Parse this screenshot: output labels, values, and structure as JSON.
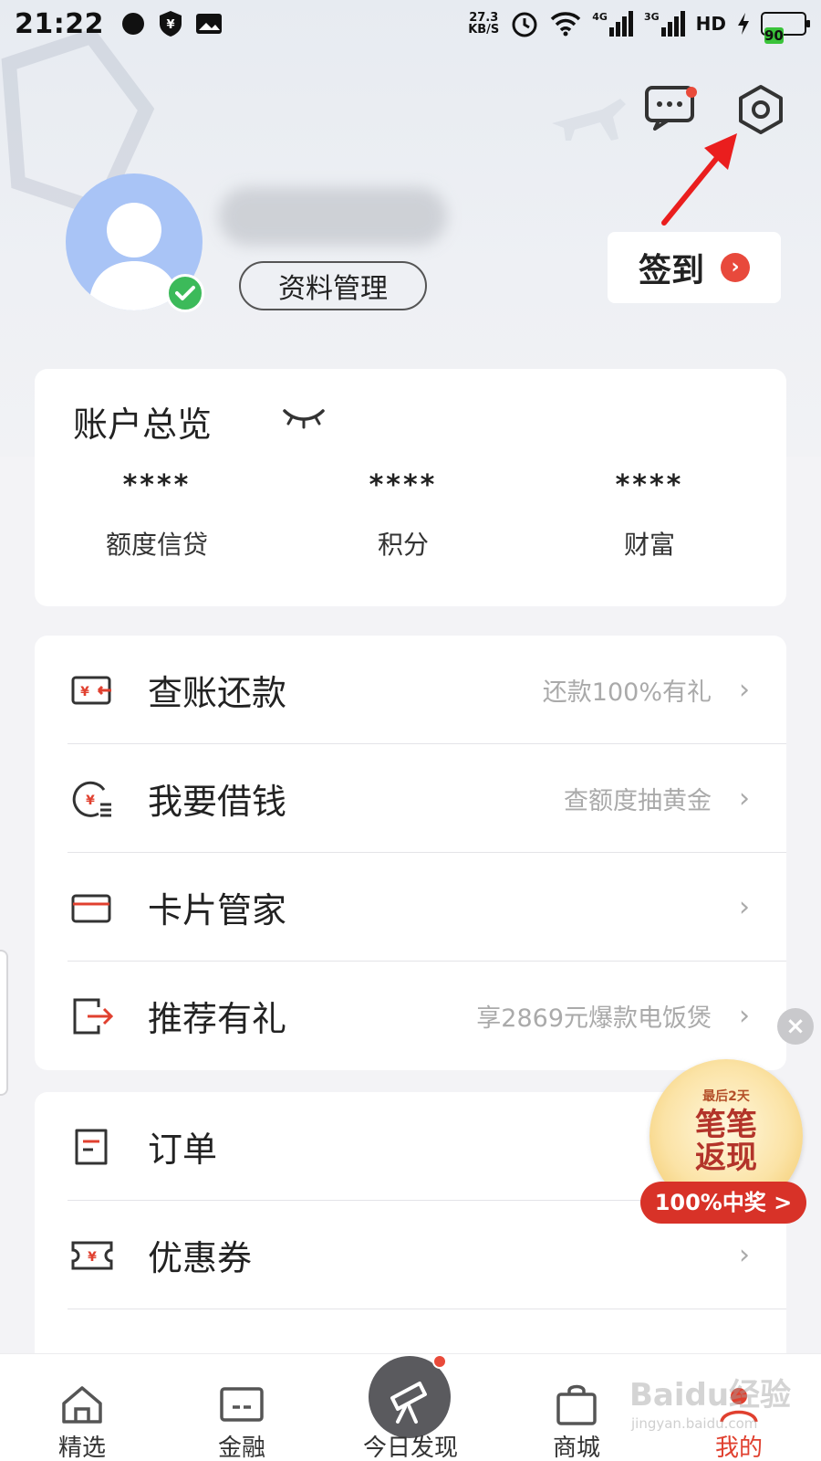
{
  "status_bar": {
    "time": "21:22",
    "speed_value": "27.3",
    "speed_unit": "KB/S",
    "net1": "4G",
    "net2": "3G",
    "hd": "HD",
    "battery": "90"
  },
  "header": {
    "profile_button": "资料管理",
    "checkin_label": "签到",
    "checkin_go": "›"
  },
  "account": {
    "title": "账户总览",
    "stats": [
      {
        "value": "****",
        "label": "额度信贷"
      },
      {
        "value": "****",
        "label": "积分"
      },
      {
        "value": "****",
        "label": "财富"
      }
    ]
  },
  "menu1": [
    {
      "title": "查账还款",
      "hint": "还款100%有礼",
      "icon": "bill-repay-icon"
    },
    {
      "title": "我要借钱",
      "hint": "查额度抽黄金",
      "icon": "borrow-money-icon"
    },
    {
      "title": "卡片管家",
      "hint": "",
      "icon": "card-icon"
    },
    {
      "title": "推荐有礼",
      "hint": "享2869元爆款电饭煲",
      "icon": "share-export-icon"
    }
  ],
  "menu2": [
    {
      "title": "订单",
      "icon": "order-icon"
    },
    {
      "title": "优惠券",
      "icon": "coupon-icon"
    }
  ],
  "chevron": "›",
  "promo": {
    "top": "最后2天",
    "main_line1": "笔笔",
    "main_line2": "返现",
    "pill": "100%中奖 >"
  },
  "nav": [
    {
      "label": "精选",
      "icon": "home-icon"
    },
    {
      "label": "金融",
      "icon": "card-icon"
    },
    {
      "label": "今日发现",
      "icon": "telescope-icon"
    },
    {
      "label": "商城",
      "icon": "shopping-bag-icon"
    },
    {
      "label": "我的",
      "icon": "profile-icon"
    }
  ],
  "watermark": {
    "main": "Baidu经验",
    "sub": "jingyan.baidu.com"
  },
  "colors": {
    "accent": "#e0402f",
    "verified": "#3cba5a",
    "avatar": "#a9c4f6"
  }
}
